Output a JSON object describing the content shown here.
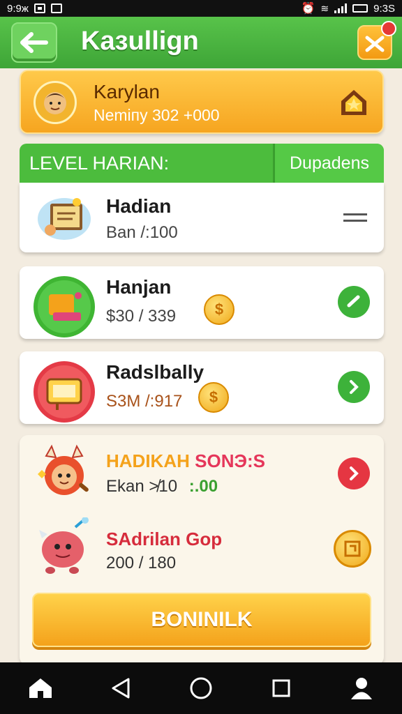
{
  "status_bar": {
    "time_left": "9:9ж",
    "time_right": "9:3S"
  },
  "header": {
    "title": "Kaзullign",
    "back_icon": "arrow-left-icon",
    "gift_icon": "gift-icon"
  },
  "profile": {
    "name": "Karylan",
    "subtitle": "Nemiпу 302 +000",
    "avatar_icon": "character-avatar-icon",
    "home_icon": "home-badge-icon"
  },
  "level": {
    "title": "LEVEL HARIAN:",
    "tab_label": "Dupadens"
  },
  "cards": [
    {
      "title": "Hadian",
      "value": "Ban /:100",
      "icon": "certificate-icon",
      "action": "menu-icon"
    },
    {
      "title": "Hanjan",
      "value": "$30 / 339",
      "coin": "$",
      "icon": "gift-box-icon",
      "action": "check-icon"
    },
    {
      "title": "Radslbally",
      "value": "S3M /:917",
      "coin": "$",
      "icon": "board-icon",
      "action": "chevron-right-icon"
    }
  ],
  "bonus_panel": {
    "row1": {
      "title_a": "HADIKAH",
      "title_b": "SONЭ:S",
      "value_a": "Ekan ≯10",
      "value_b": ":.00",
      "icon": "monster-red-icon"
    },
    "row2": {
      "title": "SAdrilan Gop",
      "value": "200 / 180",
      "icon": "monster-pink-icon"
    },
    "button_label": "BONINILK"
  },
  "colors": {
    "green": "#4cbc3d",
    "orange": "#f6a520",
    "red": "#e53642"
  }
}
